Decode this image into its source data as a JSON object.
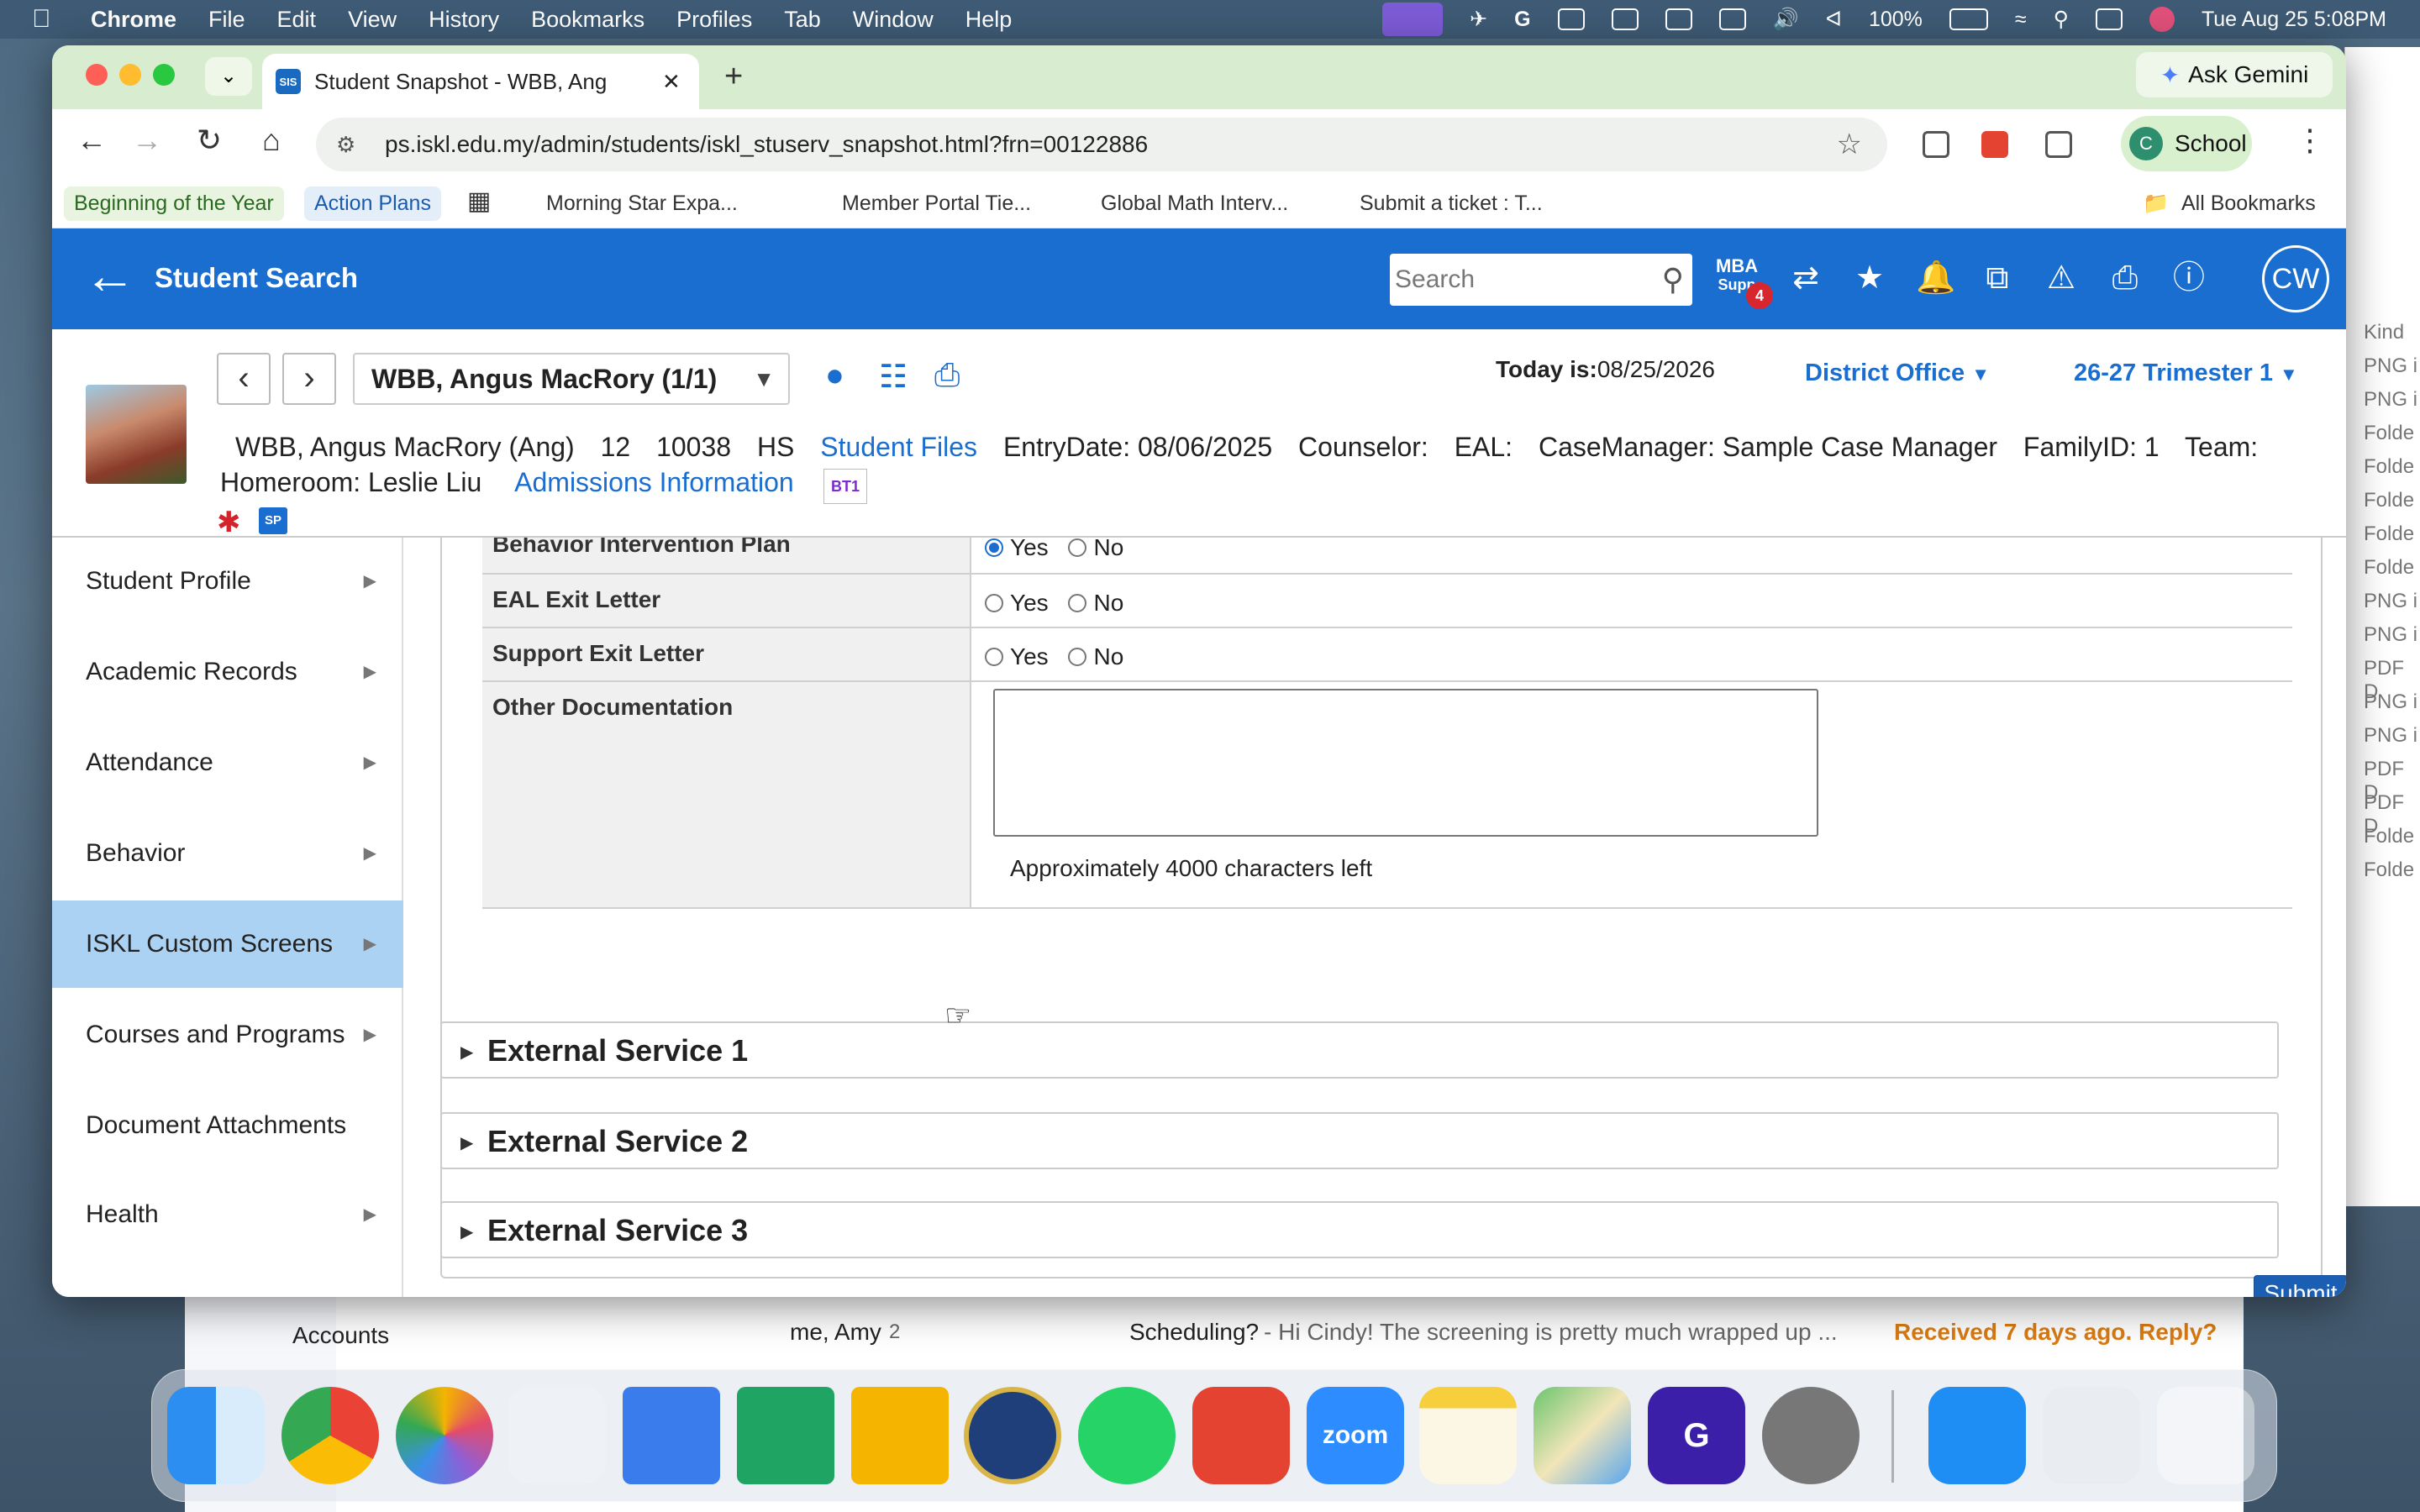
{
  "menubar": {
    "app": "Chrome",
    "items": [
      "File",
      "Edit",
      "View",
      "History",
      "Bookmarks",
      "Profiles",
      "Tab",
      "Window",
      "Help"
    ],
    "battery": "100%",
    "datetime": "Tue Aug 25  5:08PM"
  },
  "browser": {
    "tab_title": "Student Snapshot - WBB, Ang",
    "tab_favicon": "SIS",
    "ask_gemini": "Ask Gemini",
    "url": "ps.iskl.edu.my/admin/students/iskl_stuserv_snapshot.html?frn=00122886",
    "profile_initial": "C",
    "profile_label": "School",
    "bookmarks": [
      "Beginning of the Year",
      "Action Plans",
      "Morning Star Expa...",
      "Member Portal Tie...",
      "Global Math Interv...",
      "Submit a ticket : T..."
    ],
    "all_bookmarks": "All Bookmarks"
  },
  "ps_header": {
    "title": "Student Search",
    "search_placeholder": "Search",
    "mba_label": "MBA",
    "mba_sub": "Supp",
    "mba_badge": "4",
    "user_initials": "CW"
  },
  "student": {
    "selector": "WBB, Angus MacRory  (1/1)",
    "today_label": "Today is:",
    "today_value": "08/25/2026",
    "district": "District Office",
    "term": "26-27 Trimester 1",
    "name_line": "WBB, Angus MacRory (Ang)",
    "grade": "12",
    "student_number": "10038",
    "school": "HS",
    "student_files": "Student Files",
    "entry_date": "EntryDate: 08/06/2025",
    "counselor": "Counselor:",
    "eal": "EAL:",
    "case_manager": "CaseManager: Sample Case Manager",
    "family_id": "FamilyID: 1",
    "team": "Team:",
    "homeroom": "Homeroom: Leslie Liu",
    "admissions": "Admissions Information",
    "badge_bt1": "BT1",
    "badge_sp": "SP"
  },
  "sidebar": {
    "items": [
      {
        "label": "Student Profile"
      },
      {
        "label": "Academic Records"
      },
      {
        "label": "Attendance"
      },
      {
        "label": "Behavior"
      },
      {
        "label": "ISKL Custom Screens"
      },
      {
        "label": "Courses and Programs"
      },
      {
        "label": "Document Attachments"
      },
      {
        "label": "Health"
      }
    ]
  },
  "form": {
    "rows": [
      {
        "label": "Behavior Intervention Plan",
        "value": "Yes"
      },
      {
        "label": "EAL Exit Letter",
        "value": ""
      },
      {
        "label": "Support Exit Letter",
        "value": ""
      }
    ],
    "yes": "Yes",
    "no": "No",
    "other_doc_label": "Other Documentation",
    "other_doc_value": "",
    "chars_left": "Approximately 4000 characters left"
  },
  "sections": [
    {
      "label": "External Service 1"
    },
    {
      "label": "External Service 2"
    },
    {
      "label": "External Service 3"
    }
  ],
  "submit_label": "Submit",
  "background": {
    "mail_rows": [
      {
        "sender": "me, Amy",
        "count": "2",
        "subject": "Scheduling?",
        "snippet": " - Hi Cindy! The screening is pretty much wrapped up ...",
        "status": "Received 7 days ago. Reply?"
      }
    ],
    "mail_label": "Accounts",
    "finder_items": [
      "Kind",
      "PNG i",
      "PNG i",
      "Folde",
      "Folde",
      "Folde",
      "Folde",
      "Folde",
      "PNG i",
      "PNG i",
      "PDF D",
      "PNG i",
      "PNG i",
      "PDF D",
      "PDF D",
      "Folde",
      "Folde"
    ]
  },
  "dock": [
    "Finder",
    "Chrome",
    "Photos",
    "Keynote",
    "Docs",
    "Sheets",
    "Slides",
    "ISKL",
    "WhatsApp",
    "Todoist",
    "Zoom",
    "Notes",
    "Maps",
    "Grammarly",
    "Settings",
    "App Store",
    "Preview",
    "Trash"
  ]
}
